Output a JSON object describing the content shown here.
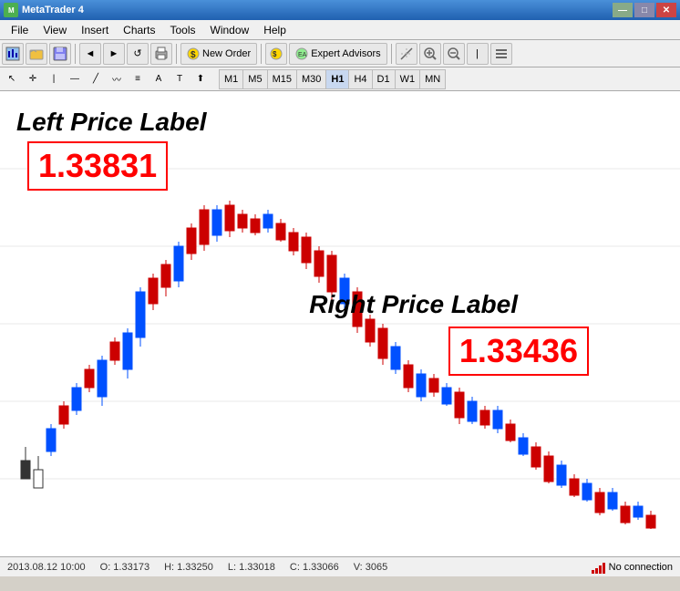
{
  "titleBar": {
    "title": "MetaTrader 4",
    "minLabel": "—",
    "maxLabel": "□",
    "closeLabel": "✕"
  },
  "menuBar": {
    "items": [
      "File",
      "View",
      "Insert",
      "Charts",
      "Tools",
      "Window",
      "Help"
    ]
  },
  "toolbar1": {
    "newOrderLabel": "New Order",
    "expertAdvisorsLabel": "Expert Advisors"
  },
  "toolbar2": {
    "timeframes": [
      "M1",
      "M5",
      "M15",
      "M30",
      "H1",
      "H4",
      "D1",
      "W1",
      "MN"
    ],
    "activeTimeframe": "H1"
  },
  "chart": {
    "leftPriceLabelText": "Left Price Label",
    "leftPriceValue": "1.33831",
    "rightPriceLabelText": "Right Price Label",
    "rightPriceValue": "1.33436"
  },
  "statusBar": {
    "datetime": "2013.08.12 10:00",
    "open": "O: 1.33173",
    "high": "H: 1.33250",
    "low": "L: 1.33018",
    "close": "C: 1.33066",
    "volume": "V: 3065",
    "noConnection": "No connection"
  }
}
